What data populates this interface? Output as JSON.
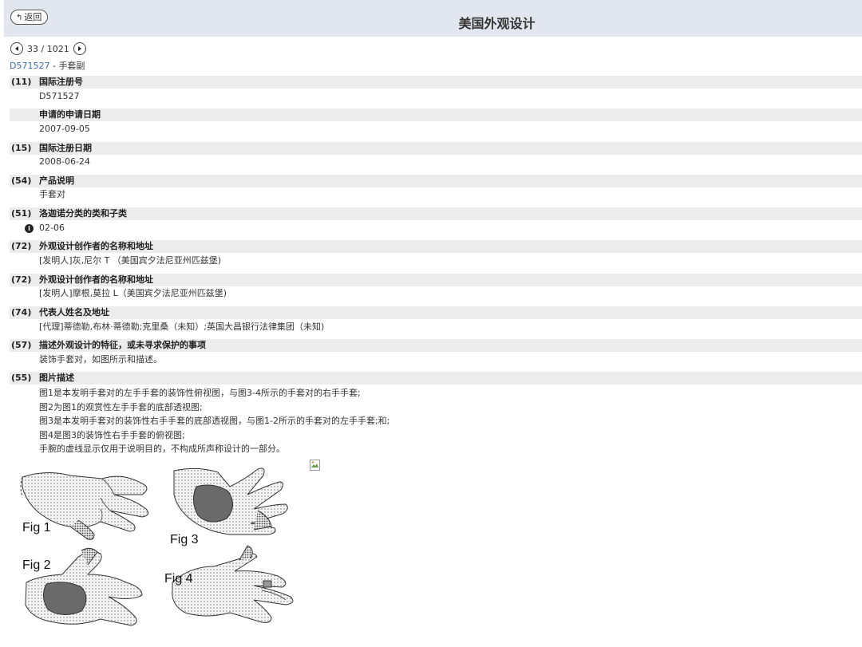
{
  "header": {
    "back_label": "返回",
    "title": "美国外观设计"
  },
  "pager": {
    "count": "33 / 1021"
  },
  "doc": {
    "number": "D571527",
    "separator": " - ",
    "name": "手套副"
  },
  "sections": [
    {
      "num": "(11)",
      "label": "国际注册号",
      "value": "D571527"
    },
    {
      "num": "",
      "label": "申请的申请日期",
      "value": "2007-09-05"
    },
    {
      "num": "(15)",
      "label": "国际注册日期",
      "value": "2008-06-24"
    },
    {
      "num": "(54)",
      "label": "产品说明",
      "value": "手套对"
    },
    {
      "num": "(51)",
      "label": "洛迦诺分类的类和子类",
      "value": "02-06"
    },
    {
      "num": "(72)",
      "label": "外观设计创作者的名称和地址",
      "value": "[发明人]灰,尼尔 T （美国宾夕法尼亚州匹兹堡)"
    },
    {
      "num": "(72)",
      "label": "外观设计创作者的名称和地址",
      "value": "[发明人]摩根,莫拉 L（美国宾夕法尼亚州匹兹堡)"
    },
    {
      "num": "(74)",
      "label": "代表人姓名及地址",
      "value": "[代理]蒂德勒,布林·蒂德勒;克里桑（未知）;英国大昌银行法律集团（未知)"
    },
    {
      "num": "(57)",
      "label": "描述外观设计的特征，或未寻求保护的事项",
      "value": "装饰手套对，如图所示和描述。"
    },
    {
      "num": "(55)",
      "label": "图片描述",
      "value": ""
    }
  ],
  "figure_description": [
    "图1是本发明手套对的左手手套的装饰性俯视图，与图3-4所示的手套对的右手手套;",
    "图2为图1的观赏性左手手套的底部透视图;",
    "图3是本发明手套对的装饰性右手手套的底部透视图，与图1-2所示的手套对的左手手套;和;",
    "图4是图3的装饰性右手手套的俯视图;",
    "手腕的虚线显示仅用于说明目的，不构成所声称设计的一部分。"
  ],
  "figures": {
    "fig1": "Fig 1",
    "fig2": "Fig 2",
    "fig3": "Fig 3",
    "fig4": "Fig 4"
  },
  "icons": {
    "back": "back-arrow-icon",
    "prev": "prev-circle-icon",
    "next": "next-circle-icon",
    "info": "info-icon",
    "broken": "broken-image-icon"
  }
}
